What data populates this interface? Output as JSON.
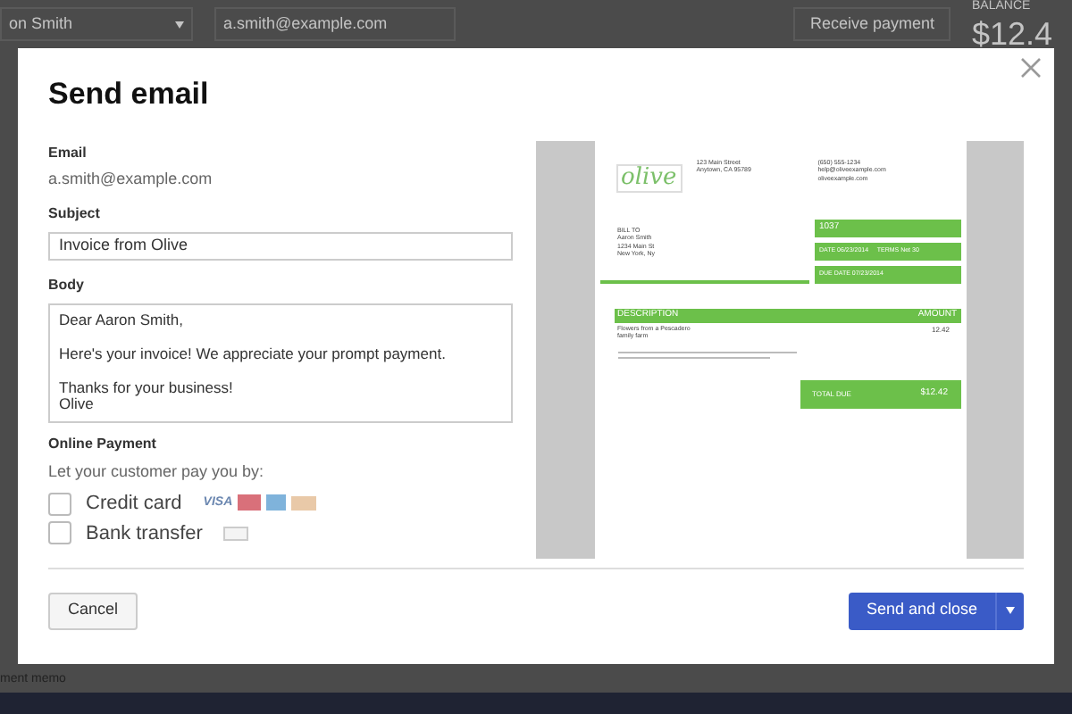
{
  "background": {
    "customer": "on Smith",
    "email": "a.smith@example.com",
    "receive_button": "Receive payment",
    "balance_label": "BALANCE",
    "balance": "$12.4",
    "memo_label": "ment memo"
  },
  "dialog": {
    "title": "Send email",
    "email": {
      "label": "Email",
      "value": "a.smith@example.com"
    },
    "subject": {
      "label": "Subject",
      "value": "Invoice from Olive"
    },
    "body": {
      "label": "Body",
      "paragraphs": [
        [
          "Dear Aaron Smith,"
        ],
        [
          "Here's your invoice! We appreciate your prompt payment."
        ],
        [
          "Thanks for your business!",
          "Olive"
        ]
      ]
    },
    "online_payment": {
      "label": "Online Payment",
      "hint": "Let your customer pay you by:",
      "options": [
        {
          "label": "Credit card",
          "checked": false,
          "kind": "card",
          "brand": "VISA"
        },
        {
          "label": "Bank transfer",
          "checked": false,
          "kind": "bank"
        }
      ]
    },
    "preview": {
      "logo": "olive",
      "address": [
        "123 Main Street",
        "Anytown, CA 95789"
      ],
      "contact": [
        "(650) 555-1234",
        "help@oliveexample.com",
        "oliveexample.com"
      ],
      "bill_to_label": "BILL TO",
      "bill_to": [
        "Aaron Smith",
        "1234 Main St",
        "New York, Ny"
      ],
      "invoice_number": "1037",
      "date_line": "DATE 06/23/2014     TERMS Net 30",
      "due_line": "DUE DATE 07/23/2014",
      "columns": [
        "DESCRIPTION",
        "AMOUNT"
      ],
      "item": "Flowers from a Pescadero family farm",
      "amount": "12.42",
      "total_label": "TOTAL DUE",
      "total": "$12.42"
    },
    "cancel": "Cancel",
    "send": "Send and close"
  }
}
